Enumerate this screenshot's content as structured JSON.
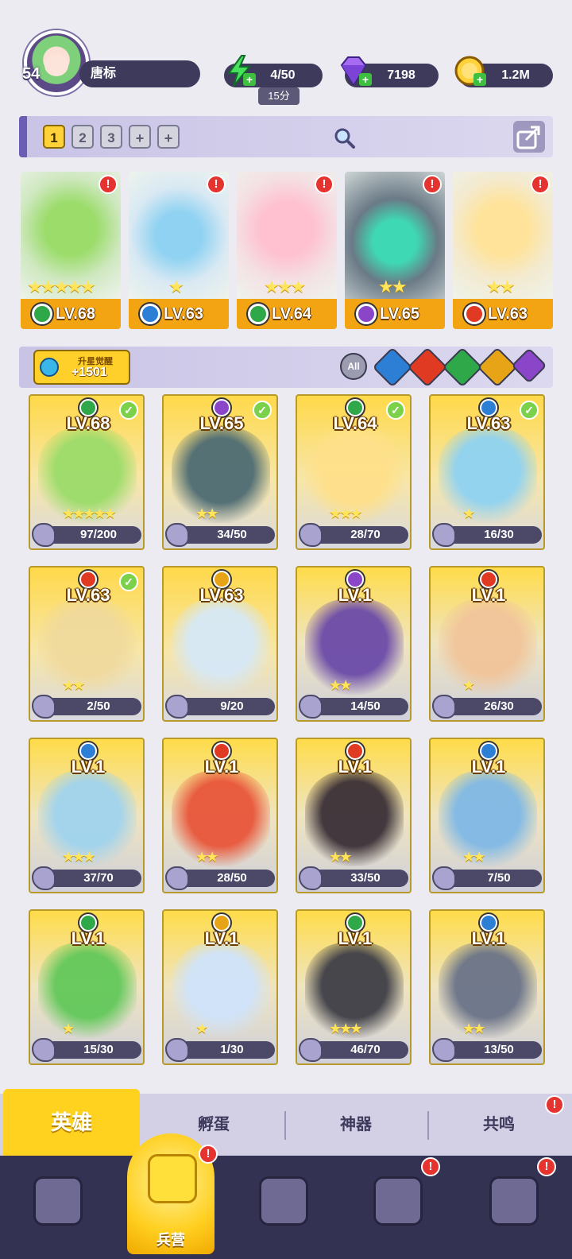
{
  "player": {
    "level": "54",
    "name": "唐标"
  },
  "resources": {
    "energy": {
      "value": "4/50",
      "timer": "15分",
      "icon": "lightning-icon"
    },
    "gems": {
      "value": "7198",
      "icon": "gem-icon"
    },
    "gold": {
      "value": "1.2M",
      "icon": "coin-icon"
    }
  },
  "team_bar": {
    "slots": [
      "1",
      "2",
      "3",
      "+",
      "+"
    ],
    "active_slot": "1"
  },
  "team": [
    {
      "level": "LV.68",
      "stars": "★★★★★",
      "element": "nature",
      "color": "#2fa84a"
    },
    {
      "level": "LV.63",
      "stars": "★",
      "element": "water",
      "color": "#2d7fd6"
    },
    {
      "level": "LV.64",
      "stars": "★★★",
      "element": "nature",
      "color": "#2fa84a"
    },
    {
      "level": "LV.65",
      "stars": "★★",
      "element": "dark",
      "color": "#8a45c9"
    },
    {
      "level": "LV.63",
      "stars": "★★",
      "element": "fire",
      "color": "#e03a22"
    }
  ],
  "awaken": {
    "label": "升星觉醒",
    "value": "+1501"
  },
  "filters": {
    "all_label": "All"
  },
  "heroes": [
    {
      "level": "LV.68",
      "shards": "97/200",
      "element": "nature",
      "color": "#2fa84a",
      "checked": true,
      "stars": "★★★★★"
    },
    {
      "level": "LV.65",
      "shards": "34/50",
      "element": "dark",
      "color": "#8a45c9",
      "checked": true,
      "stars": "★★"
    },
    {
      "level": "LV.64",
      "shards": "28/70",
      "element": "nature",
      "color": "#2fa84a",
      "checked": true,
      "stars": "★★★"
    },
    {
      "level": "LV.63",
      "shards": "16/30",
      "element": "water",
      "color": "#2d7fd6",
      "checked": true,
      "stars": "★"
    },
    {
      "level": "LV.63",
      "shards": "2/50",
      "element": "fire",
      "color": "#e03a22",
      "checked": true,
      "stars": "★★"
    },
    {
      "level": "LV.63",
      "shards": "9/20",
      "element": "light",
      "color": "#e6a416",
      "checked": false,
      "stars": ""
    },
    {
      "level": "LV.1",
      "shards": "14/50",
      "element": "dark",
      "color": "#8a45c9",
      "checked": false,
      "stars": "★★"
    },
    {
      "level": "LV.1",
      "shards": "26/30",
      "element": "fire",
      "color": "#e03a22",
      "checked": false,
      "stars": "★"
    },
    {
      "level": "LV.1",
      "shards": "37/70",
      "element": "water",
      "color": "#2d7fd6",
      "checked": false,
      "stars": "★★★"
    },
    {
      "level": "LV.1",
      "shards": "28/50",
      "element": "fire",
      "color": "#e03a22",
      "checked": false,
      "stars": "★★"
    },
    {
      "level": "LV.1",
      "shards": "33/50",
      "element": "fire",
      "color": "#e03a22",
      "checked": false,
      "stars": "★★"
    },
    {
      "level": "LV.1",
      "shards": "7/50",
      "element": "water",
      "color": "#2d7fd6",
      "checked": false,
      "stars": "★★"
    },
    {
      "level": "LV.1",
      "shards": "15/30",
      "element": "nature",
      "color": "#2fa84a",
      "checked": false,
      "stars": "★"
    },
    {
      "level": "LV.1",
      "shards": "1/30",
      "element": "light",
      "color": "#e6a416",
      "checked": false,
      "stars": "★"
    },
    {
      "level": "LV.1",
      "shards": "46/70",
      "element": "nature",
      "color": "#2fa84a",
      "checked": false,
      "stars": "★★★"
    },
    {
      "level": "LV.1",
      "shards": "13/50",
      "element": "water",
      "color": "#2d7fd6",
      "checked": false,
      "stars": "★★"
    }
  ],
  "subtabs": [
    "英雄",
    "孵蛋",
    "神器",
    "共鸣"
  ],
  "nav": {
    "active_label": "兵营"
  },
  "colors": {
    "accent": "#ffd21f",
    "dark": "#343252",
    "panel": "#d3d0e6"
  }
}
